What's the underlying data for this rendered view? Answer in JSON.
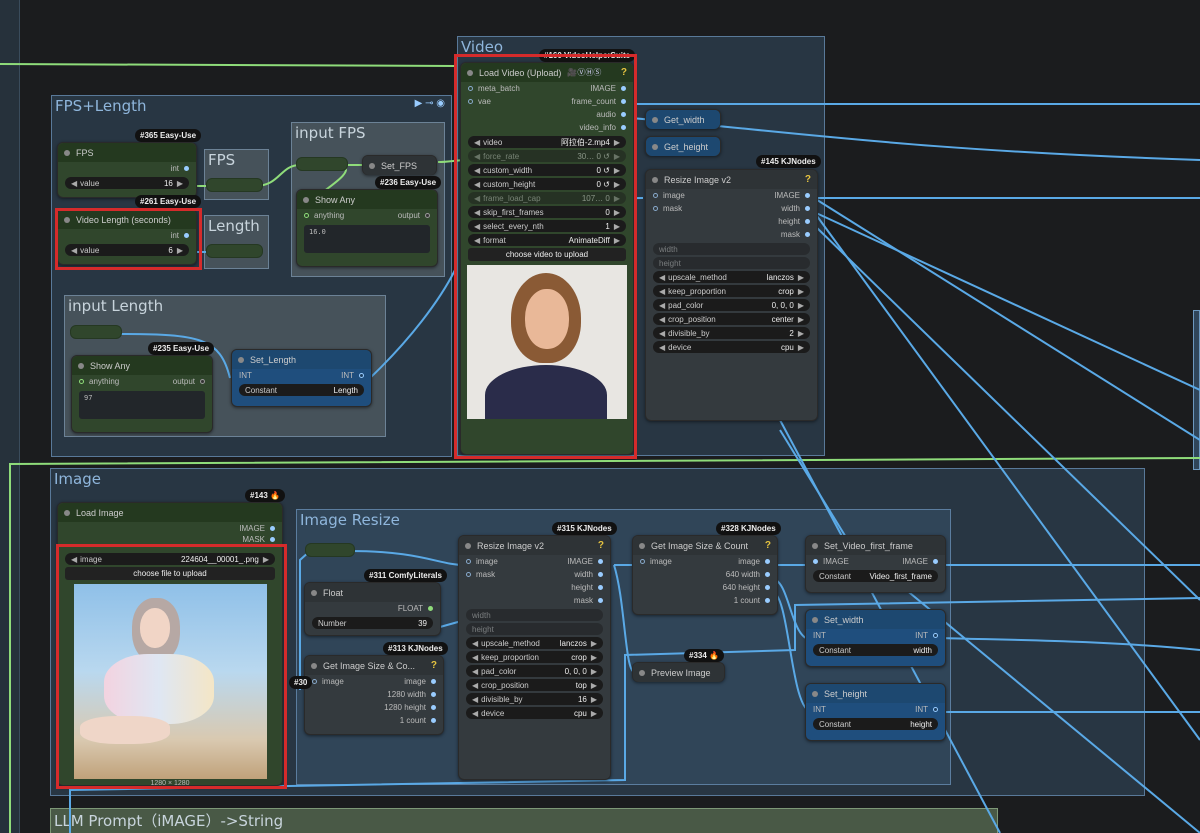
{
  "groups": {
    "video": "Video",
    "fps_length": "FPS+Length",
    "input_fps": "input FPS",
    "fps_small": "FPS",
    "length_small": "Length",
    "input_length": "input Length",
    "image": "Image",
    "image_resize": "Image Resize",
    "llm_prompt": "LLM Prompt（iMAGE）->String"
  },
  "badges": {
    "vhs": "#160 VideoHelperSuite",
    "n365": "#365 Easy-Use",
    "n261": "#261 Easy-Use",
    "n236": "#236 Easy-Use",
    "n235": "#235 Easy-Use",
    "n145": "#145 KJNodes",
    "n143": "#143 🔥",
    "n315": "#315 KJNodes",
    "n328": "#328 KJNodes",
    "n311": "#311 ComfyLiterals",
    "n313": "#313 KJNodes",
    "n334": "#334 🔥",
    "n30": "#30"
  },
  "fps_node": {
    "title": "FPS",
    "out": "int",
    "value_label": "value",
    "value": "16"
  },
  "video_length_node": {
    "title": "Video Length (seconds)",
    "out": "int",
    "value_label": "value",
    "value": "6"
  },
  "show_any_1": {
    "title": "Show Any",
    "in": "anything",
    "out": "output",
    "text": "16.0"
  },
  "show_any_2": {
    "title": "Show Any",
    "in": "anything",
    "out": "output",
    "text": "97"
  },
  "set_fps": {
    "title": "Set_FPS"
  },
  "set_length": {
    "title": "Set_Length",
    "in": "INT",
    "out": "INT",
    "w_label": "Constant",
    "w_value": "Length"
  },
  "load_video": {
    "title": "Load Video (Upload)",
    "icons": "🎥ⓋⒽⓈ",
    "inputs": [
      "meta_batch",
      "vae"
    ],
    "outputs": [
      "IMAGE",
      "frame_count",
      "audio",
      "video_info"
    ],
    "widgets": [
      {
        "label": "video",
        "value": "阿拉伯-2.mp4",
        "dis": false
      },
      {
        "label": "force_rate",
        "value": "30… 0 ↺",
        "dis": true
      },
      {
        "label": "custom_width",
        "value": "0 ↺",
        "dis": false
      },
      {
        "label": "custom_height",
        "value": "0 ↺",
        "dis": false
      },
      {
        "label": "frame_load_cap",
        "value": "107… 0",
        "dis": true
      },
      {
        "label": "skip_first_frames",
        "value": "0",
        "dis": false
      },
      {
        "label": "select_every_nth",
        "value": "1",
        "dis": false
      },
      {
        "label": "format",
        "value": "AnimateDiff",
        "dis": false
      }
    ],
    "button": "choose video to upload"
  },
  "get_width": {
    "title": "Get_width"
  },
  "get_height": {
    "title": "Get_height"
  },
  "resize_v2_top": {
    "title": "Resize Image v2",
    "inputs": [
      "image",
      "mask"
    ],
    "outputs": [
      "IMAGE",
      "width",
      "height",
      "mask"
    ],
    "disabled": [
      "width",
      "height"
    ],
    "widgets": [
      {
        "label": "upscale_method",
        "value": "lanczos"
      },
      {
        "label": "keep_proportion",
        "value": "crop"
      },
      {
        "label": "pad_color",
        "value": "0, 0, 0"
      },
      {
        "label": "crop_position",
        "value": "center"
      },
      {
        "label": "divisible_by",
        "value": "2"
      },
      {
        "label": "device",
        "value": "cpu"
      }
    ]
  },
  "load_image": {
    "title": "Load Image",
    "outputs": [
      "IMAGE",
      "MASK"
    ],
    "widget_label": "image",
    "widget_value": "224604__00001_.png",
    "button": "choose file to upload",
    "size": "1280 × 1280"
  },
  "float_node": {
    "title": "Float",
    "out": "FLOAT",
    "w_label": "Number",
    "w_value": "39"
  },
  "get_size_1": {
    "title": "Get Image Size & Co...",
    "in": "image",
    "outputs": [
      "image",
      "1280 width",
      "1280 height",
      "1 count"
    ]
  },
  "resize_v2_bottom": {
    "title": "Resize Image v2",
    "inputs": [
      "image",
      "mask"
    ],
    "outputs": [
      "IMAGE",
      "width",
      "height",
      "mask"
    ],
    "disabled": [
      "width",
      "height"
    ],
    "widgets": [
      {
        "label": "upscale_method",
        "value": "lanczos"
      },
      {
        "label": "keep_proportion",
        "value": "crop"
      },
      {
        "label": "pad_color",
        "value": "0, 0, 0"
      },
      {
        "label": "crop_position",
        "value": "top"
      },
      {
        "label": "divisible_by",
        "value": "16"
      },
      {
        "label": "device",
        "value": "cpu"
      }
    ]
  },
  "get_size_2": {
    "title": "Get Image Size & Count",
    "in": "image",
    "outputs": [
      "image",
      "640 width",
      "640 height",
      "1 count"
    ]
  },
  "preview": {
    "title": "Preview Image"
  },
  "set_vff": {
    "title": "Set_Video_first_frame",
    "in": "IMAGE",
    "out": "IMAGE",
    "w_label": "Constant",
    "w_value": "Video_first_frame"
  },
  "set_width": {
    "title": "Set_width",
    "in": "INT",
    "out": "INT",
    "w_label": "Constant",
    "w_value": "width"
  },
  "set_height": {
    "title": "Set_height",
    "in": "INT",
    "out": "INT",
    "w_label": "Constant",
    "w_value": "height"
  },
  "colors": {
    "green_wire": "#8fdc7a",
    "blue_wire": "#5aa9e6",
    "red_box": "#d52b2b",
    "group_title": "#8fb6dc"
  }
}
